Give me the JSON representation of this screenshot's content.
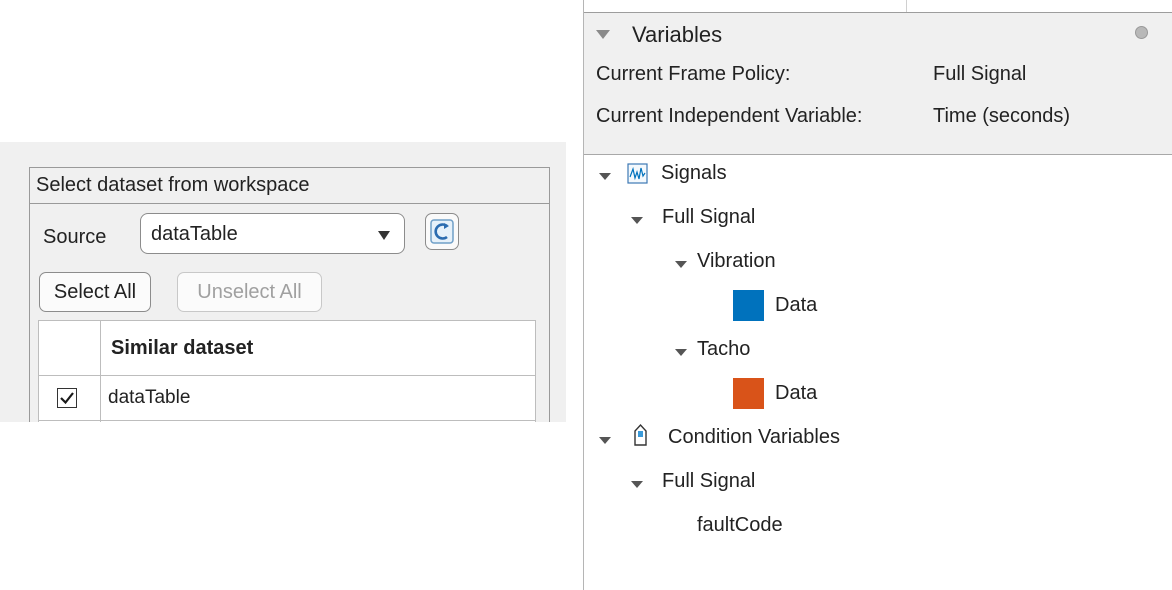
{
  "dataset_panel": {
    "group_title": "Select dataset from workspace",
    "source_label": "Source",
    "source_value": "dataTable",
    "select_all_label": "Select All",
    "unselect_all_label": "Unselect All",
    "table": {
      "column_header": "Similar dataset",
      "rows": [
        {
          "checked": true,
          "name": "dataTable"
        }
      ]
    }
  },
  "variables_panel": {
    "title": "Variables",
    "frame_policy_label": "Current Frame Policy:",
    "frame_policy_value": "Full Signal",
    "independent_var_label": "Current Independent Variable:",
    "independent_var_value": "Time (seconds)",
    "tree": {
      "signals_label": "Signals",
      "signals_full_signal": "Full Signal",
      "vibration_label": "Vibration",
      "vibration_data": "Data",
      "tacho_label": "Tacho",
      "tacho_data": "Data",
      "conditions_label": "Condition Variables",
      "conditions_full_signal": "Full Signal",
      "fault_code": "faultCode"
    }
  },
  "colors": {
    "vibration_swatch": "#0072bd",
    "tacho_swatch": "#d95319"
  }
}
